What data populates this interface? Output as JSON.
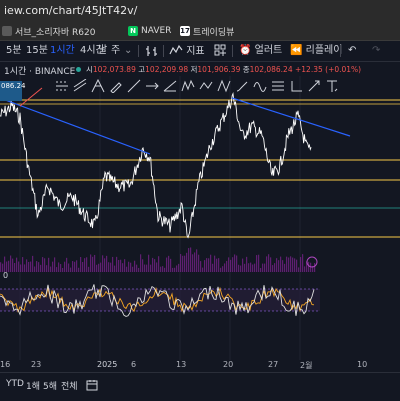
{
  "browser": {
    "url": "iew.com/chart/45JtT42v/",
    "bookmarks": [
      {
        "label": "서브_소리자바 R620",
        "icon": "site-icon",
        "color": "#5a5a5a"
      },
      {
        "label": "NAVER",
        "icon": "naver-icon",
        "color": "#03c75a"
      },
      {
        "label": "트레이딩뷰",
        "icon": "tradingview-icon",
        "color": "#ffffff"
      }
    ]
  },
  "toolbar": {
    "interval_5m": "5분",
    "interval_15m": "15분",
    "interval_1h": "1시간",
    "interval_4h": "4시간",
    "interval_day": "날",
    "interval_week": "주",
    "indicators_label": "지표",
    "alert_label": "얼러트",
    "replay_label": "리플레이"
  },
  "legend": {
    "symbol": "1시간 · BINANCE",
    "open_label": "시",
    "open": "102,073.89",
    "high_label": "고",
    "high": "102,209.98",
    "low_label": "저",
    "low": "101,906.39",
    "close_label": "종",
    "close": "102,086.24",
    "change": "+12.35 (+0.01%)"
  },
  "price_badge": "086.24",
  "oscillator_label": "0",
  "x_ticks": [
    "16",
    "23",
    "2025",
    "6",
    "13",
    "20",
    "27",
    "2월",
    "10"
  ],
  "bottom_bar": {
    "ytd": "YTD",
    "y1": "1해",
    "y5": "5해",
    "all": "전체"
  },
  "colors": {
    "background": "#131722",
    "price_line": "#ffffff",
    "trendline": "#2962ff",
    "level_line": "#f7c948",
    "green_line": "#26a69a",
    "volume": "#9c27b0",
    "oscillator": "#e0e0e0",
    "oscillator_signal": "#f5a623"
  }
}
